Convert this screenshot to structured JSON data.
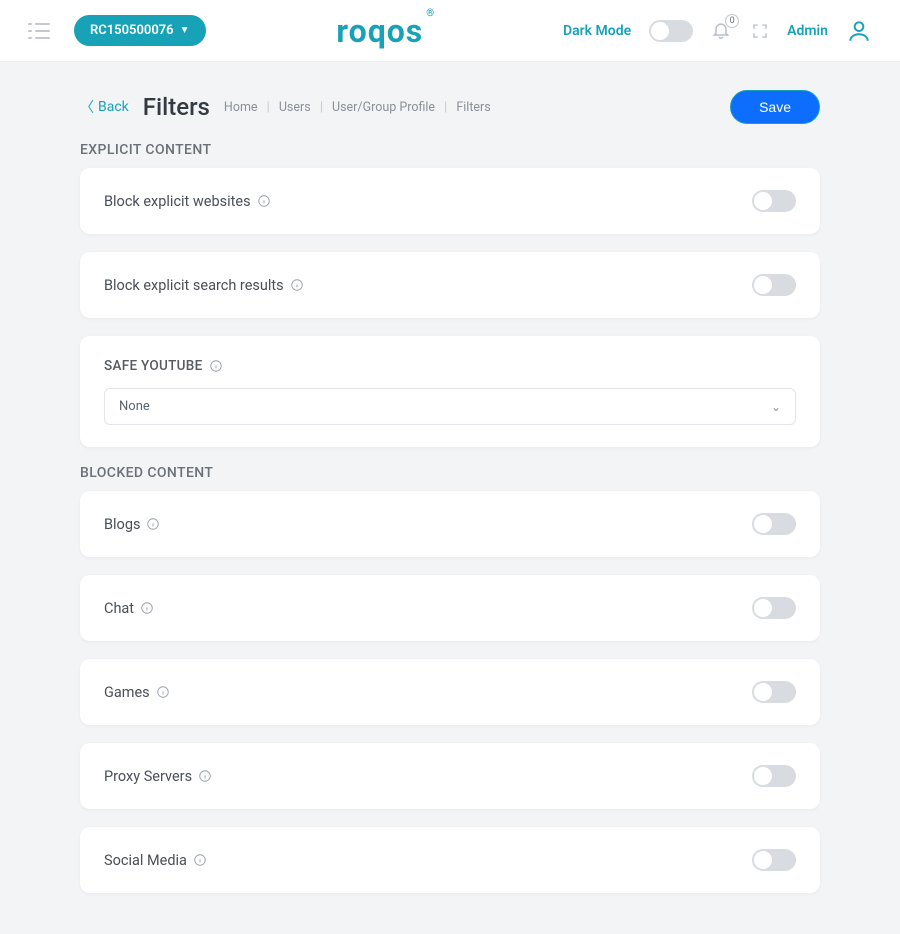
{
  "topbar": {
    "device_id": "RC150500076",
    "brand": "roqos",
    "dark_mode_label": "Dark Mode",
    "notification_count": "0",
    "admin_label": "Admin"
  },
  "header": {
    "back_label": "Back",
    "title": "Filters",
    "breadcrumb": [
      "Home",
      "Users",
      "User/Group Profile",
      "Filters"
    ],
    "save_label": "Save"
  },
  "sections": {
    "explicit": {
      "label": "EXPLICIT CONTENT",
      "items": [
        {
          "label": "Block explicit websites"
        },
        {
          "label": "Block explicit search results"
        }
      ],
      "safe_youtube": {
        "label": "SAFE YOUTUBE",
        "selected": "None"
      }
    },
    "blocked": {
      "label": "BLOCKED CONTENT",
      "items": [
        {
          "label": "Blogs"
        },
        {
          "label": "Chat"
        },
        {
          "label": "Games"
        },
        {
          "label": "Proxy Servers"
        },
        {
          "label": "Social Media"
        }
      ]
    }
  }
}
